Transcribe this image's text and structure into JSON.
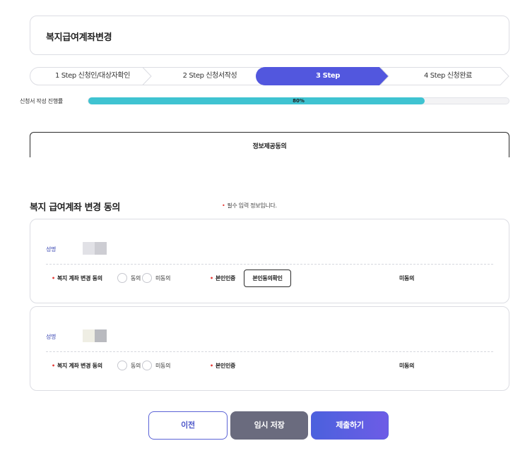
{
  "page": {
    "title": "복지급여계좌변경"
  },
  "steps": [
    {
      "label": "1 Step 신청인/대상자확인",
      "active": false
    },
    {
      "label": "2 Step 신청서작성",
      "active": false
    },
    {
      "label": "3 Step",
      "active": true
    },
    {
      "label": "4 Step 신청완료",
      "active": false
    }
  ],
  "progress": {
    "label": "신청서 작성 진행률",
    "value": 80,
    "text": "80%"
  },
  "info_section": {
    "label": "정보제공동의"
  },
  "consent": {
    "title": "복지 급여계좌 변경 동의",
    "required_note": "필수 입력 정보입니다.",
    "people": [
      {
        "name_label": "성명",
        "consent_label": "복지 계좌 변경 동의",
        "option_agree": "동의",
        "option_disagree": "미동의",
        "identity_label": "본인인증",
        "verify_button": "본인동의확인",
        "status": "미동의"
      },
      {
        "name_label": "성명",
        "consent_label": "복지 계좌 변경 동의",
        "option_agree": "동의",
        "option_disagree": "미동의",
        "identity_label": "본인인증",
        "status": "미동의"
      }
    ]
  },
  "buttons": {
    "prev": "이전",
    "temp_save": "임시 저장",
    "submit": "제출하기"
  },
  "colors": {
    "accent": "#4b61dd",
    "progress": "#3fc3d1",
    "required": "#e53935",
    "name_label": "#3d4ab4"
  }
}
